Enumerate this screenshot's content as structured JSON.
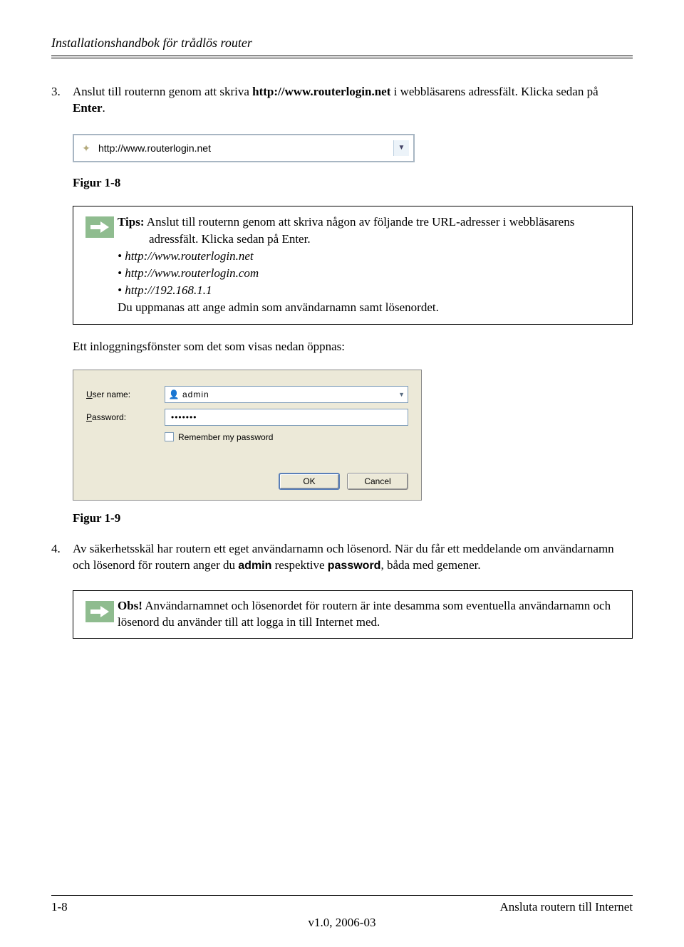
{
  "header": {
    "title": "Installationshandbok för trådlös router"
  },
  "step3": {
    "num": "3.",
    "text_a": "Anslut till routernn genom att skriva ",
    "bold_url": "http://www.routerlogin.net",
    "text_b": " i webbläsarens adressfält. Klicka sedan på ",
    "bold_enter": "Enter",
    "text_c": "."
  },
  "addr_bar": {
    "url": "http://www.routerlogin.net"
  },
  "figure8": {
    "caption": "Figur 1-8"
  },
  "tip": {
    "lead_bold": "Tips:",
    "lead_rest": " Anslut till routernn genom att skriva någon av följande tre URL-adresser i webbläsarens",
    "line2": "adressfält. Klicka sedan på Enter.",
    "link1": "• http://www.routerlogin.net",
    "link2": "• http://www.routerlogin.com",
    "link3": "• http://192.168.1.1",
    "last": "Du uppmanas att ange admin som användarnamn samt lösenordet."
  },
  "after_tip": "Ett inloggningsfönster som det som visas nedan öppnas:",
  "dialog": {
    "user_label_u": "U",
    "user_label_rest": "ser name:",
    "pass_label_u": "P",
    "pass_label_rest": "assword:",
    "user_value": "admin",
    "pass_value": "•••••••",
    "remember": "Remember my password",
    "ok": "OK",
    "cancel": "Cancel"
  },
  "figure9": {
    "caption": "Figur 1-9"
  },
  "step4": {
    "num": "4.",
    "text_a": "Av säkerhetsskäl har routern ett eget användarnamn och lösenord. När du får ett meddelande om användarnamn och lösenord för routern anger du ",
    "bold_admin": "admin",
    "text_b": " respektive ",
    "bold_pw": "password",
    "text_c": ", båda med gemener."
  },
  "obs": {
    "lead_bold": "Obs!",
    "text": " Användarnamnet och lösenordet för routern är inte desamma som eventuella användarnamn och lösenord du använder till att logga in till Internet med."
  },
  "footer": {
    "left": "1-8",
    "right": "Ansluta routern till Internet",
    "center": "v1.0, 2006-03"
  }
}
